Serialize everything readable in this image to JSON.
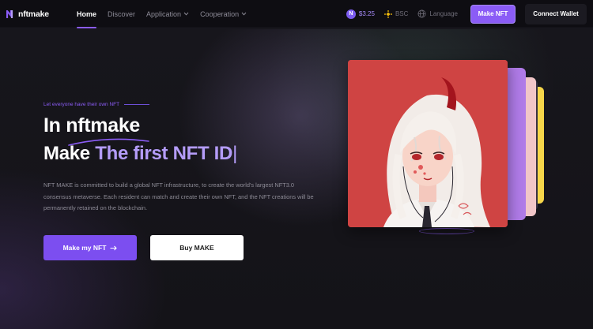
{
  "header": {
    "logo_text": "nftmake",
    "nav": [
      {
        "label": "Home",
        "active": true
      },
      {
        "label": "Discover"
      },
      {
        "label": "Application",
        "has_dropdown": true
      },
      {
        "label": "Cooperation",
        "has_dropdown": true
      }
    ],
    "token_price": "$3.25",
    "token_symbol": "N",
    "chain": "BSC",
    "language_label": "Language",
    "make_nft_button": "Make NFT",
    "connect_wallet_button": "Connect Wallet"
  },
  "hero": {
    "tagline": "Let everyone have their own NFT",
    "title_line1": "In nftmake",
    "title_line2_prefix": "Make",
    "title_line2_accent": "The first NFT ID",
    "title_caret": "|",
    "description": "NFT MAKE is committed to build a global NFT infrastructure, to create the world's largest NFT3.0 consensus metaverse. Each resident can match and create their own NFT, and the NFT creations will be permanently retained on the blockchain.",
    "primary_button": "Make my NFT",
    "secondary_button": "Buy MAKE"
  },
  "colors": {
    "accent": "#8b5cf6",
    "background": "#131218",
    "card_red": "#cf4443",
    "card_purple": "#b07be8",
    "card_pink": "#f1c6c8",
    "card_yellow": "#f6d64a"
  }
}
